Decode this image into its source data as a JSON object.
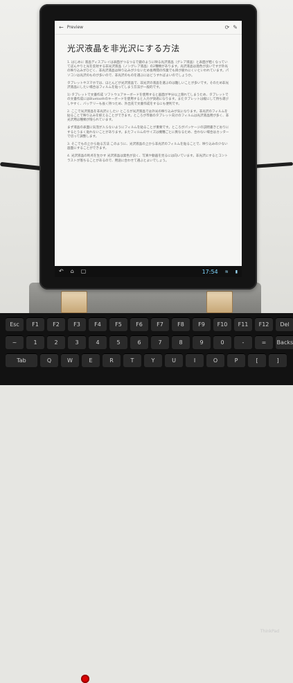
{
  "preview": {
    "title": "Preview",
    "back_icon": "back-arrow-icon",
    "action_icons": [
      "refresh-icon",
      "edit-icon"
    ]
  },
  "document": {
    "heading": "光沢液晶を非光沢にする方法",
    "paragraphs": [
      "1. はじめに\n液晶ディスプレイは表面がつるつるで鏡のように映る光沢液晶（グレア液晶）と表面が粗くなっていてぼんやりと光を反射する非光沢液晶（ノングレア液晶）の2種類があります。光沢液晶は発色が良いですが外光の映り込みがひどく、非光沢液晶は映り込みが少ないため長時間の作業でも目が疲れにくいといわれています。パソコンは光沢のものが多いので、非光沢のものを選ぶにはどうすればよいのでしょうか。",
      "タブレットやスマホでは、ほとんどが光沢液晶で、非光沢の液晶を選ぶのは難しいことが多いです。そのため非光沢液晶にしたい場合はフィルムを貼ってしまう方法が一般的です。",
      "1) タブレットで文書作成\nソフトウェアキーボードを使用すると画面が半分以上隠れてしまうため、タブレットでの文書作成にはBluetoothのキーボードを使用すると入力が快適になります。またタブレットは縦にして持ち運びしやすく、バッテリーも長く持つため、外出先で文書作成をするにも便利です。",
      "2. ここで光沢液晶を非光沢にしたい\nところが光沢液晶では外光の映り込みが気になります。非光沢のフィルムを貼ることで映り込みを抑えることができます。ところが市販のタブレット向けのフィルムは光沢液晶用が多く、非光沢用は種類が限られています。",
      "まず液晶の表面に気泡が入らないようにフィルムを貼ることが重要です。ところがパッケージの説明書きどおりにするとうまく貼れないことがあります。またフィルムのサイズは機種ごとに異なるため、合わない場合はカッターで切って調整します。",
      "3. そこでもの上から貼る方法\nこのように、光沢液晶の上から非光沢のフィルムを貼ることで、映り込みの少ない画面にすることができます。",
      "4. 光沢液晶の利点を生かす\n光沢液晶は発色が良く、写真や動画を見るには向いています。非光沢にするとコントラストが落ちることがあるので、用途に合わせて選ぶとよいでしょう。"
    ]
  },
  "nav": {
    "back_icon": "nav-back-icon",
    "home_icon": "nav-home-icon",
    "recent_icon": "nav-recent-icon",
    "clock": "17:54",
    "status_icons": [
      "wifi-icon",
      "battery-icon"
    ]
  },
  "keyboard": {
    "brand_label": "ThinkPad",
    "row1": [
      "Esc",
      "F1",
      "F2",
      "F3",
      "F4",
      "F5",
      "F6",
      "F7",
      "F8",
      "F9",
      "F10",
      "F11",
      "F12",
      "Del"
    ],
    "row2": [
      "~",
      "1",
      "2",
      "3",
      "4",
      "5",
      "6",
      "7",
      "8",
      "9",
      "0",
      "-",
      "=",
      "Backspace"
    ],
    "row3": [
      "Tab",
      "Q",
      "W",
      "E",
      "R",
      "T",
      "Y",
      "U",
      "I",
      "O",
      "P",
      "[",
      "]"
    ]
  }
}
